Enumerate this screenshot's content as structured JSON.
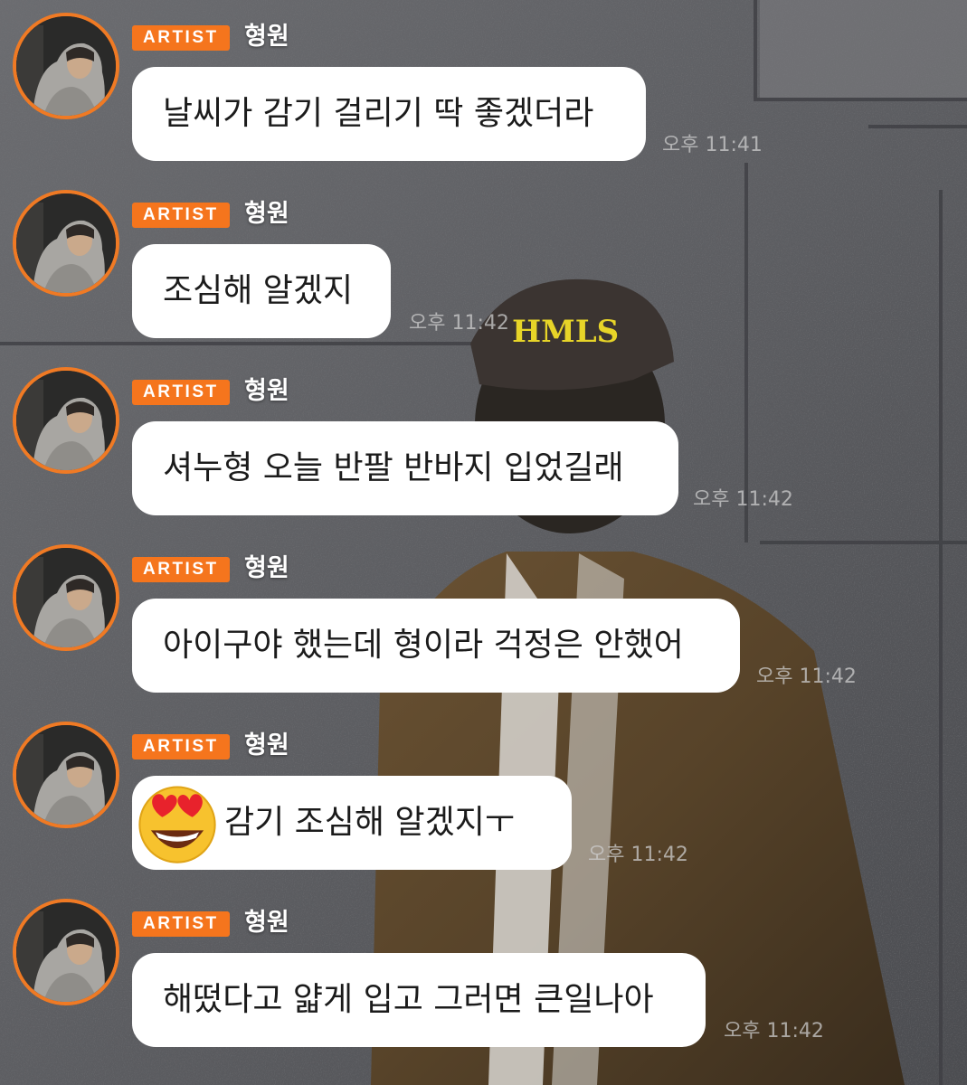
{
  "colors": {
    "badge": "#f5751d",
    "avatar_ring": "#f07a24",
    "bubble": "#ffffff"
  },
  "messages": [
    {
      "badge": "ARTIST",
      "sender": "형원",
      "text": "날씨가 감기 걸리기 딱 좋겠더라",
      "time": "오후 11:41",
      "emoji": null
    },
    {
      "badge": "ARTIST",
      "sender": "형원",
      "text": "조심해 알겠지",
      "time": "오후 11:42",
      "emoji": null
    },
    {
      "badge": "ARTIST",
      "sender": "형원",
      "text": "셔누형 오늘 반팔 반바지 입었길래",
      "time": "오후 11:42",
      "emoji": null
    },
    {
      "badge": "ARTIST",
      "sender": "형원",
      "text": "아이구야 했는데 형이라 걱정은 안했어",
      "time": "오후 11:42",
      "emoji": null
    },
    {
      "badge": "ARTIST",
      "sender": "형원",
      "text": "감기 조심해 알겠지ㅜ",
      "time": "오후 11:42",
      "emoji": "heart-eyes-emoji"
    },
    {
      "badge": "ARTIST",
      "sender": "형원",
      "text": "해떴다고 얇게 입고 그러면 큰일나아",
      "time": "오후 11:42",
      "emoji": null
    }
  ],
  "background": {
    "cap_text": "HMLS"
  }
}
